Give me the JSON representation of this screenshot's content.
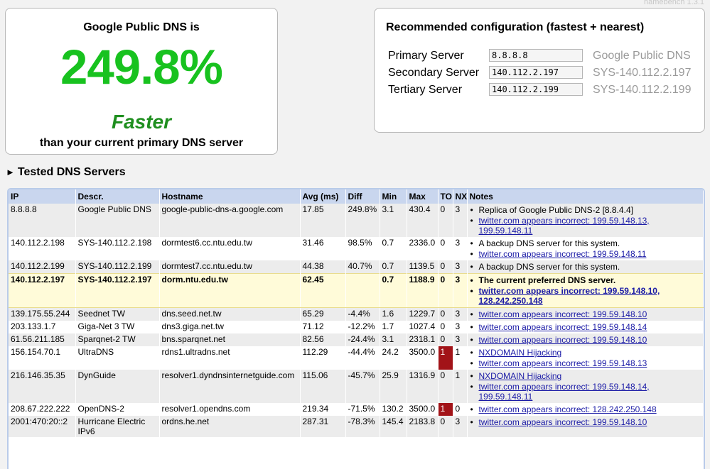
{
  "app": {
    "version": "namebench 1.3.1"
  },
  "summary": {
    "heading": "Google Public DNS is",
    "percent": "249.8%",
    "word": "Faster",
    "subtext": "than your current primary DNS server"
  },
  "recommended": {
    "title": "Recommended configuration (fastest + nearest)",
    "rows": [
      {
        "label": "Primary Server",
        "ip": "8.8.8.8",
        "desc": "Google Public DNS"
      },
      {
        "label": "Secondary Server",
        "ip": "140.112.2.197",
        "desc": "SYS-140.112.2.197"
      },
      {
        "label": "Tertiary Server",
        "ip": "140.112.2.199",
        "desc": "SYS-140.112.2.199"
      }
    ]
  },
  "section": {
    "title": "Tested DNS Servers"
  },
  "table": {
    "headers": [
      "IP",
      "Descr.",
      "Hostname",
      "Avg (ms)",
      "Diff",
      "Min",
      "Max",
      "TO",
      "NX",
      "Notes"
    ],
    "rows": [
      {
        "ip": "8.8.8.8",
        "descr": "Google Public DNS",
        "host": "google-public-dns-a.google.com",
        "avg": "17.85",
        "diff": "249.8%",
        "min": "3.1",
        "max": "430.4",
        "to": "0",
        "nx": "3",
        "notes": [
          {
            "text": "Replica of Google Public DNS-2 [8.8.4.4]",
            "link": false
          },
          {
            "text": "twitter.com appears incorrect: 199.59.148.13, 199.59.148.11",
            "link": true
          }
        ]
      },
      {
        "ip": "140.112.2.198",
        "descr": "SYS-140.112.2.198",
        "host": "dormtest6.cc.ntu.edu.tw",
        "avg": "31.46",
        "diff": "98.5%",
        "min": "0.7",
        "max": "2336.0",
        "to": "0",
        "nx": "3",
        "notes": [
          {
            "text": "A backup DNS server for this system.",
            "link": false
          },
          {
            "text": "twitter.com appears incorrect: 199.59.148.11",
            "link": true
          }
        ]
      },
      {
        "ip": "140.112.2.199",
        "descr": "SYS-140.112.2.199",
        "host": "dormtest7.cc.ntu.edu.tw",
        "avg": "44.38",
        "diff": "40.7%",
        "min": "0.7",
        "max": "1139.5",
        "to": "0",
        "nx": "3",
        "notes": [
          {
            "text": "A backup DNS server for this system.",
            "link": false
          }
        ]
      },
      {
        "ip": "140.112.2.197",
        "descr": "SYS-140.112.2.197",
        "host": "dorm.ntu.edu.tw",
        "avg": "62.45",
        "diff": "",
        "min": "0.7",
        "max": "1188.9",
        "to": "0",
        "nx": "3",
        "current": true,
        "notes": [
          {
            "text": "The current preferred DNS server.",
            "link": false
          },
          {
            "text": "twitter.com appears incorrect: 199.59.148.10, 128.242.250.148",
            "link": true
          }
        ]
      },
      {
        "ip": "139.175.55.244",
        "descr": "Seednet TW",
        "host": "dns.seed.net.tw",
        "avg": "65.29",
        "diff": "-4.4%",
        "min": "1.6",
        "max": "1229.7",
        "to": "0",
        "nx": "3",
        "notes": [
          {
            "text": "twitter.com appears incorrect: 199.59.148.10",
            "link": true
          }
        ]
      },
      {
        "ip": "203.133.1.7",
        "descr": "Giga-Net 3 TW",
        "host": "dns3.giga.net.tw",
        "avg": "71.12",
        "diff": "-12.2%",
        "min": "1.7",
        "max": "1027.4",
        "to": "0",
        "nx": "3",
        "notes": [
          {
            "text": "twitter.com appears incorrect: 199.59.148.14",
            "link": true
          }
        ]
      },
      {
        "ip": "61.56.211.185",
        "descr": "Sparqnet-2 TW",
        "host": "bns.sparqnet.net",
        "avg": "82.56",
        "diff": "-24.4%",
        "min": "3.1",
        "max": "2318.1",
        "to": "0",
        "nx": "3",
        "notes": [
          {
            "text": "twitter.com appears incorrect: 199.59.148.10",
            "link": true
          }
        ]
      },
      {
        "ip": "156.154.70.1",
        "descr": "UltraDNS",
        "host": "rdns1.ultradns.net",
        "avg": "112.29",
        "diff": "-44.4%",
        "min": "24.2",
        "max": "3500.0",
        "to": "1",
        "nx": "1",
        "to_hot": true,
        "notes": [
          {
            "text": "NXDOMAIN Hijacking",
            "link": true
          },
          {
            "text": "twitter.com appears incorrect: 199.59.148.13",
            "link": true
          }
        ]
      },
      {
        "ip": "216.146.35.35",
        "descr": "DynGuide",
        "host": "resolver1.dyndnsinternetguide.com",
        "avg": "115.06",
        "diff": "-45.7%",
        "min": "25.9",
        "max": "1316.9",
        "to": "0",
        "nx": "1",
        "notes": [
          {
            "text": "NXDOMAIN Hijacking",
            "link": true
          },
          {
            "text": "twitter.com appears incorrect: 199.59.148.14, 199.59.148.11",
            "link": true
          }
        ]
      },
      {
        "ip": "208.67.222.222",
        "descr": "OpenDNS-2",
        "host": "resolver1.opendns.com",
        "avg": "219.34",
        "diff": "-71.5%",
        "min": "130.2",
        "max": "3500.0",
        "to": "1",
        "nx": "0",
        "to_hot": true,
        "notes": [
          {
            "text": "twitter.com appears incorrect: 128.242.250.148",
            "link": true
          }
        ]
      },
      {
        "ip": "2001:470:20::2",
        "descr": "Hurricane Electric IPv6",
        "host": "ordns.he.net",
        "avg": "287.31",
        "diff": "-78.3%",
        "min": "145.4",
        "max": "2183.8",
        "to": "0",
        "nx": "3",
        "notes": [
          {
            "text": "twitter.com appears incorrect: 199.59.148.10",
            "link": true
          }
        ]
      }
    ]
  }
}
